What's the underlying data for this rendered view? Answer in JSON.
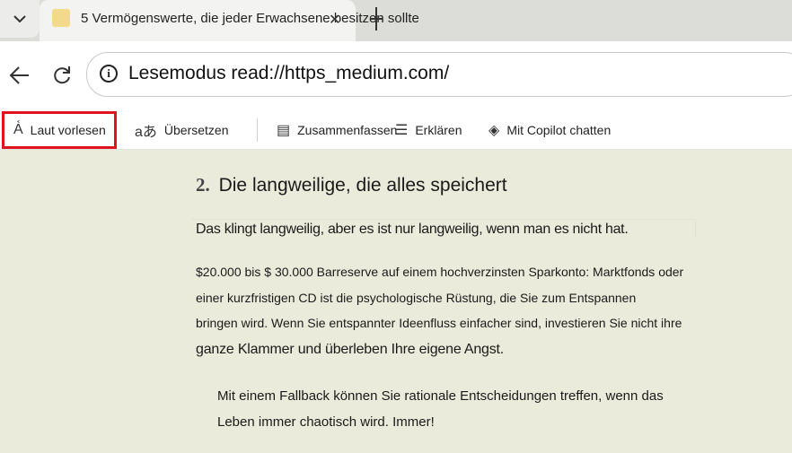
{
  "tab": {
    "title": "5 Vermögenswerte, die jeder Erwachsene besitzen sollte",
    "close_glyph": "✕"
  },
  "address": {
    "text": "Lesemodus read://https_medium.com/"
  },
  "toolbar": {
    "read_aloud": "Laut vorlesen",
    "translate": "Übersetzen",
    "summarize": "Zusammenfassen",
    "explain": "Erklären",
    "copilot": "Mit Copilot chatten"
  },
  "article": {
    "heading_number": "2.",
    "heading_text": "Die langweilige, die alles speichert",
    "p1": "Das klingt langweilig, aber es ist nur langweilig, wenn man es nicht hat.",
    "p2_lines": [
      "$20.000 bis $ 30.000 Barreserve auf einem hochverzinsten Sparkonto: Marktfonds oder",
      "einer kurzfristigen CD ist die psychologische Rüstung, die Sie zum Entspannen",
      "bringen wird. Wenn Sie entspannter Ideenfluss einfacher sind, investieren Sie nicht ihre",
      "ganze Klammer und überleben Ihre eigene Angst."
    ],
    "quote_lines": [
      "Mit einem Fallback können Sie rationale Entscheidungen treffen, wenn das",
      "Leben immer chaotisch wird. Immer!"
    ]
  },
  "icons": [
    "tab-list-icon",
    "back-arrow-icon",
    "refresh-icon",
    "info-icon",
    "read-aloud-icon",
    "translate-icon",
    "summarize-icon",
    "explain-icon",
    "copilot-icon"
  ]
}
